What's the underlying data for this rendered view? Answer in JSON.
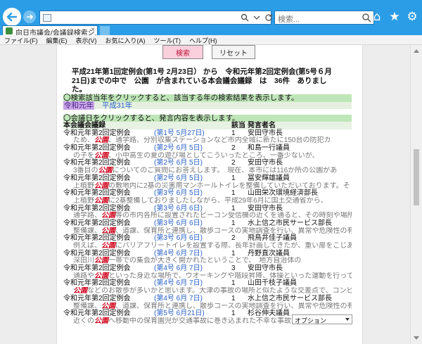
{
  "browser": {
    "search_placeholder": "検索...",
    "tab_title": "向日市議会/会議録検索シ...",
    "tab_close": "×",
    "icons": [
      "home-icon",
      "star-icon",
      "gear-icon"
    ]
  },
  "menu": [
    "ファイル(F)",
    "編集(E)",
    "表示(V)",
    "お気に入り(A)",
    "ツール(T)",
    "ヘルプ(H)"
  ],
  "buttons": {
    "search": "検索",
    "reset": "リセット"
  },
  "summary": "平成21年第1回定例会(第1号 2月23日） から　令和元年第2回定例会(第5号６月21日)までの中で　公園　が含まれている本会議会議録　は　36件　ありました。",
  "year_hint": "〇検索該当年をクリックすると、該当する年の検索結果を表示します。",
  "years": {
    "selected": "令和元年",
    "other": "平成31年"
  },
  "date_hint": "〇会議日をクリックすると、発言内容を表示します。",
  "table_header": {
    "col1": "本会議会議録",
    "col2": "",
    "col3": "該当",
    "col4": "発言者名"
  },
  "results": [
    {
      "session": "令和元年第2回定例会",
      "date": "(第1号 5月27日)",
      "count": "1",
      "speaker": "安田守市長",
      "pre": "ため、",
      "kw": "公園",
      "post": "、通学路、分別収集ステーションなど市内全域に新たに150台の防犯カ"
    },
    {
      "session": "令和元年第2回定例会",
      "date": "(第2号 6月 5日)",
      "count": "2",
      "speaker": "和島一行議員",
      "pre": "の子を",
      "kw": "公園",
      "post": "、小中高生の夏の遊び場としてこういったところ、一番少ないが、"
    },
    {
      "session": "令和元年第2回定例会",
      "date": "(第2号 6月 5日)",
      "count": "2",
      "speaker": "安田守市長",
      "pre": "3番目の",
      "kw": "公園",
      "post": "についてのご質問にお答えします。　現在、本市には116か所の公園があ"
    },
    {
      "session": "令和元年第2回定例会",
      "date": "(第2号 6月 5日)",
      "count": "1",
      "speaker": "冨安輝雄議員",
      "pre": "上植野",
      "kw": "公園",
      "post": "の敷地内に2基の災害用マンホールトイレを整備していただいております。そ"
    },
    {
      "session": "令和元年第2回定例会",
      "date": "(第3号 6月 5日)",
      "count": "1",
      "speaker": "山田栄次環境経済部長",
      "pre": "上植野",
      "kw": "公園",
      "post": "に2基整備しておりましたしながら、平成29年6月に国土交通省から、"
    },
    {
      "session": "令和元年第2回定例会",
      "date": "(第3号 6月 6日)",
      "count": "1",
      "speaker": "安田守市長",
      "pre": "通学路、",
      "kw": "公園",
      "post": "等の市内各所に設置されたビーコン受信機の近くを通ると、その時刻や場所が"
    },
    {
      "session": "令和元年第2回定例会",
      "date": "(第3号 6月 6日)",
      "count": "1",
      "speaker": "水上信之市民サービス部長",
      "pre": "整備課、",
      "kw": "公園",
      "post": "、道課、保育所と連携し、散歩コースの実地調査を行い、異常や危険性の有無"
    },
    {
      "session": "令和元年第2回定例会",
      "date": "(第3号 6月 6日)",
      "count": "2",
      "speaker": "飛鳥井佳子議員",
      "pre": "例えば、",
      "kw": "公園",
      "post": "にバリアフリートイレを設置する際、長年計画してきたが、重い扉をこじあけ"
    },
    {
      "session": "令和元年第2回定例会",
      "date": "(第4号 6月 7日)",
      "count": "1",
      "speaker": "丹野直次議員",
      "pre": "深田川",
      "kw": "公園",
      "post": "一帯での集会が大きく開かれたということで、　地方自治体の"
    },
    {
      "session": "令和元年第2回定例会",
      "date": "(第4号 6月 7日)",
      "count": "3",
      "speaker": "安田守市長",
      "pre": "通路や",
      "kw": "公園",
      "post": "といった身近な場所で、ウオーキングや階段昇降、体操といった運動を行って"
    },
    {
      "session": "令和元年第2回定例会",
      "date": "(第4号 6月 7日)",
      "count": "1",
      "speaker": "山田千枝子議員",
      "pre": "",
      "kw": "公園",
      "post": "などのお散歩が多いかと思います。大津の事故の場所と似たような交差点で、コンビ"
    },
    {
      "session": "令和元年第2回定例会",
      "date": "(第4号 6月 7日)",
      "count": "1",
      "speaker": "水上信之市民サービス部長",
      "pre": "整備課、",
      "kw": "公園",
      "post": "、道課、保育所と連携し、散歩コースの実地調査を行い、異常や危険性の有無"
    },
    {
      "session": "令和元年第2回定例会",
      "date": "(第5号 6月21日)",
      "count": "1",
      "speaker": "杉谷伸夫議員",
      "pre": "近くの",
      "kw": "公園",
      "post": "へ移動中の保育園児が交通事故に巻き込まれた不幸な事故は、地上園庭を持た"
    }
  ],
  "option_select": "オプション"
}
